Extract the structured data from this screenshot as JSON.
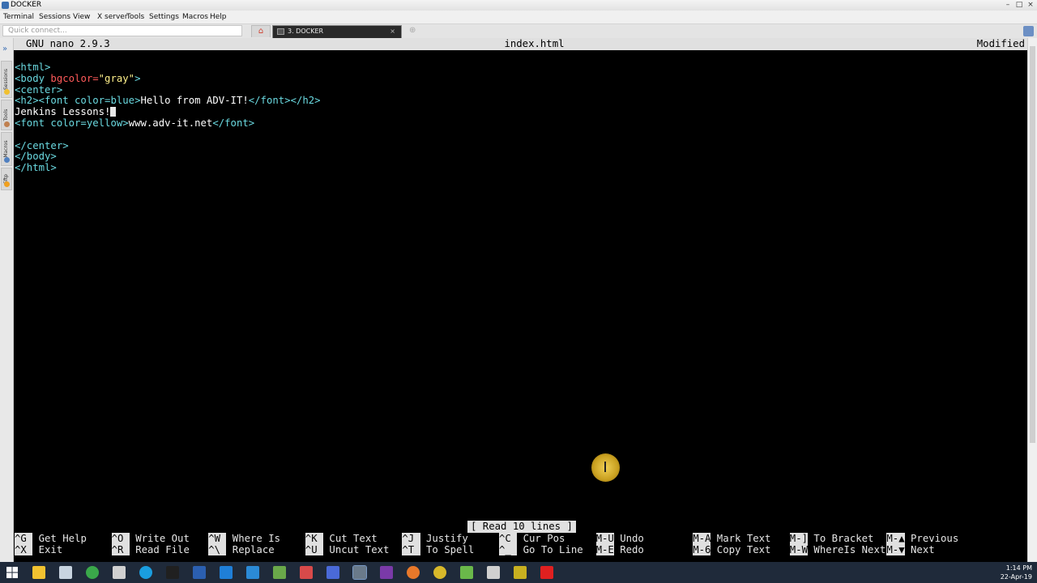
{
  "window": {
    "title": "DOCKER"
  },
  "menu": [
    "Terminal",
    "Sessions",
    "View",
    "X server",
    "Tools",
    "Settings",
    "Macros",
    "Help"
  ],
  "quick_connect": {
    "placeholder": "Quick connect..."
  },
  "tab": {
    "label": "3. DOCKER",
    "close": "×"
  },
  "sidebar_tabs": [
    "Sessions",
    "Tools",
    "Macros",
    "Sftp"
  ],
  "nano": {
    "version": "GNU nano 2.9.3",
    "filename": "index.html",
    "status": "Modified"
  },
  "file_lines": [
    [
      {
        "c": "tag",
        "t": "<html>"
      }
    ],
    [
      {
        "c": "tag",
        "t": "<body "
      },
      {
        "c": "attr",
        "t": "bgcolor="
      },
      {
        "c": "val",
        "t": "\"gray\""
      },
      {
        "c": "tag",
        "t": ">"
      }
    ],
    [
      {
        "c": "tag",
        "t": "<center>"
      }
    ],
    [
      {
        "c": "tag",
        "t": "<h2><font color=blue>"
      },
      {
        "c": "txt",
        "t": "Hello from ADV-IT!"
      },
      {
        "c": "tag",
        "t": "</font></h2>"
      }
    ],
    [
      {
        "c": "txt",
        "t": "Jenkins Lessons!"
      },
      {
        "c": "cursor",
        "t": ""
      }
    ],
    [
      {
        "c": "tag",
        "t": "<font color=yellow>"
      },
      {
        "c": "txt",
        "t": "www.adv-it.net"
      },
      {
        "c": "tag",
        "t": "</font>"
      }
    ],
    [],
    [
      {
        "c": "tag",
        "t": "</center>"
      }
    ],
    [
      {
        "c": "tag",
        "t": "</body>"
      }
    ],
    [
      {
        "c": "tag",
        "t": "</html>"
      }
    ]
  ],
  "status_message": "[ Read 10 lines ]",
  "shortcuts": [
    {
      "key": "^G",
      "label": "Get Help"
    },
    {
      "key": "^X",
      "label": "Exit"
    },
    {
      "key": "^O",
      "label": "Write Out"
    },
    {
      "key": "^R",
      "label": "Read File"
    },
    {
      "key": "^W",
      "label": "Where Is"
    },
    {
      "key": "^\\",
      "label": "Replace"
    },
    {
      "key": "^K",
      "label": "Cut Text"
    },
    {
      "key": "^U",
      "label": "Uncut Text"
    },
    {
      "key": "^J",
      "label": "Justify"
    },
    {
      "key": "^T",
      "label": "To Spell"
    },
    {
      "key": "^C",
      "label": "Cur Pos"
    },
    {
      "key": "^_",
      "label": "Go To Line"
    },
    {
      "key": "M-U",
      "label": "Undo"
    },
    {
      "key": "M-E",
      "label": "Redo"
    },
    {
      "key": "M-A",
      "label": "Mark Text"
    },
    {
      "key": "M-6",
      "label": "Copy Text"
    },
    {
      "key": "M-]",
      "label": "To Bracket"
    },
    {
      "key": "M-W",
      "label": "WhereIs Next"
    },
    {
      "key": "M-▲",
      "label": "Previous"
    },
    {
      "key": "M-▼",
      "label": "Next"
    }
  ],
  "taskbar_icons": [
    {
      "name": "windows-start-icon",
      "color": "#ffffff"
    },
    {
      "name": "file-explorer-icon",
      "color": "#f2c230"
    },
    {
      "name": "settings-app-icon",
      "color": "#c8d4e0"
    },
    {
      "name": "green-app-icon",
      "color": "#3aa84a"
    },
    {
      "name": "calculator-icon",
      "color": "#d0d0d0"
    },
    {
      "name": "skype-icon",
      "color": "#1a9ee0"
    },
    {
      "name": "terminal-icon",
      "color": "#202020"
    },
    {
      "name": "powershell-icon",
      "color": "#2b5fb0"
    },
    {
      "name": "edge-icon",
      "color": "#1f7fd8"
    },
    {
      "name": "internet-explorer-icon",
      "color": "#2b8ad6"
    },
    {
      "name": "map-app-icon",
      "color": "#6aa84a"
    },
    {
      "name": "grid-app-icon",
      "color": "#d84a4a"
    },
    {
      "name": "shield-app-icon",
      "color": "#4a6ad8"
    },
    {
      "name": "mobaxterm-icon",
      "color": "#6a7a8a"
    },
    {
      "name": "slack-icon",
      "color": "#7a3aa8"
    },
    {
      "name": "firefox-icon",
      "color": "#e8782a"
    },
    {
      "name": "chrome-icon",
      "color": "#d8b82a"
    },
    {
      "name": "notepadpp-icon",
      "color": "#6ab84a"
    },
    {
      "name": "print-app-icon",
      "color": "#d0d0d0"
    },
    {
      "name": "package-app-icon",
      "color": "#c8b020"
    },
    {
      "name": "record-app-icon",
      "color": "#e02020"
    }
  ],
  "clock": {
    "time": "1:14 PM",
    "date": "22-Apr-19"
  }
}
